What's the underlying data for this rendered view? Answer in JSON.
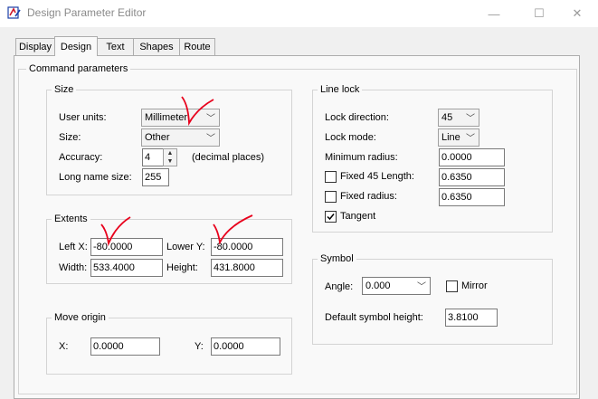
{
  "window": {
    "title": "Design Parameter Editor",
    "minimize": "—",
    "maximize": "☐",
    "close": "✕"
  },
  "tabs": [
    "Display",
    "Design",
    "Text",
    "Shapes",
    "Route"
  ],
  "command_parameters": {
    "title": "Command parameters",
    "size": {
      "title": "Size",
      "user_units_label": "User units:",
      "user_units_value": "Millimeter",
      "size_label": "Size:",
      "size_value": "Other",
      "accuracy_label": "Accuracy:",
      "accuracy_value": "4",
      "accuracy_unit": "(decimal places)",
      "long_name_label": "Long name size:",
      "long_name_value": "255"
    },
    "extents": {
      "title": "Extents",
      "left_x_label": "Left X:",
      "left_x_value": "-80.0000",
      "lower_y_label": "Lower Y:",
      "lower_y_value": "-80.0000",
      "width_label": "Width:",
      "width_value": "533.4000",
      "height_label": "Height:",
      "height_value": "431.8000"
    },
    "move_origin": {
      "title": "Move origin",
      "x_label": "X:",
      "x_value": "0.0000",
      "y_label": "Y:",
      "y_value": "0.0000"
    },
    "line_lock": {
      "title": "Line lock",
      "lock_direction_label": "Lock direction:",
      "lock_direction_value": "45",
      "lock_mode_label": "Lock mode:",
      "lock_mode_value": "Line",
      "minimum_radius_label": "Minimum radius:",
      "minimum_radius_value": "0.0000",
      "fixed45_label": "Fixed 45 Length:",
      "fixed45_value": "0.6350",
      "fixed45_checked": false,
      "fixed_radius_label": "Fixed radius:",
      "fixed_radius_value": "0.6350",
      "fixed_radius_checked": false,
      "tangent_label": "Tangent",
      "tangent_checked": true
    },
    "symbol": {
      "title": "Symbol",
      "angle_label": "Angle:",
      "angle_value": "0.000",
      "mirror_label": "Mirror",
      "mirror_checked": false,
      "default_height_label": "Default symbol height:",
      "default_height_value": "3.8100"
    }
  },
  "annotation_color": "#e8001c"
}
